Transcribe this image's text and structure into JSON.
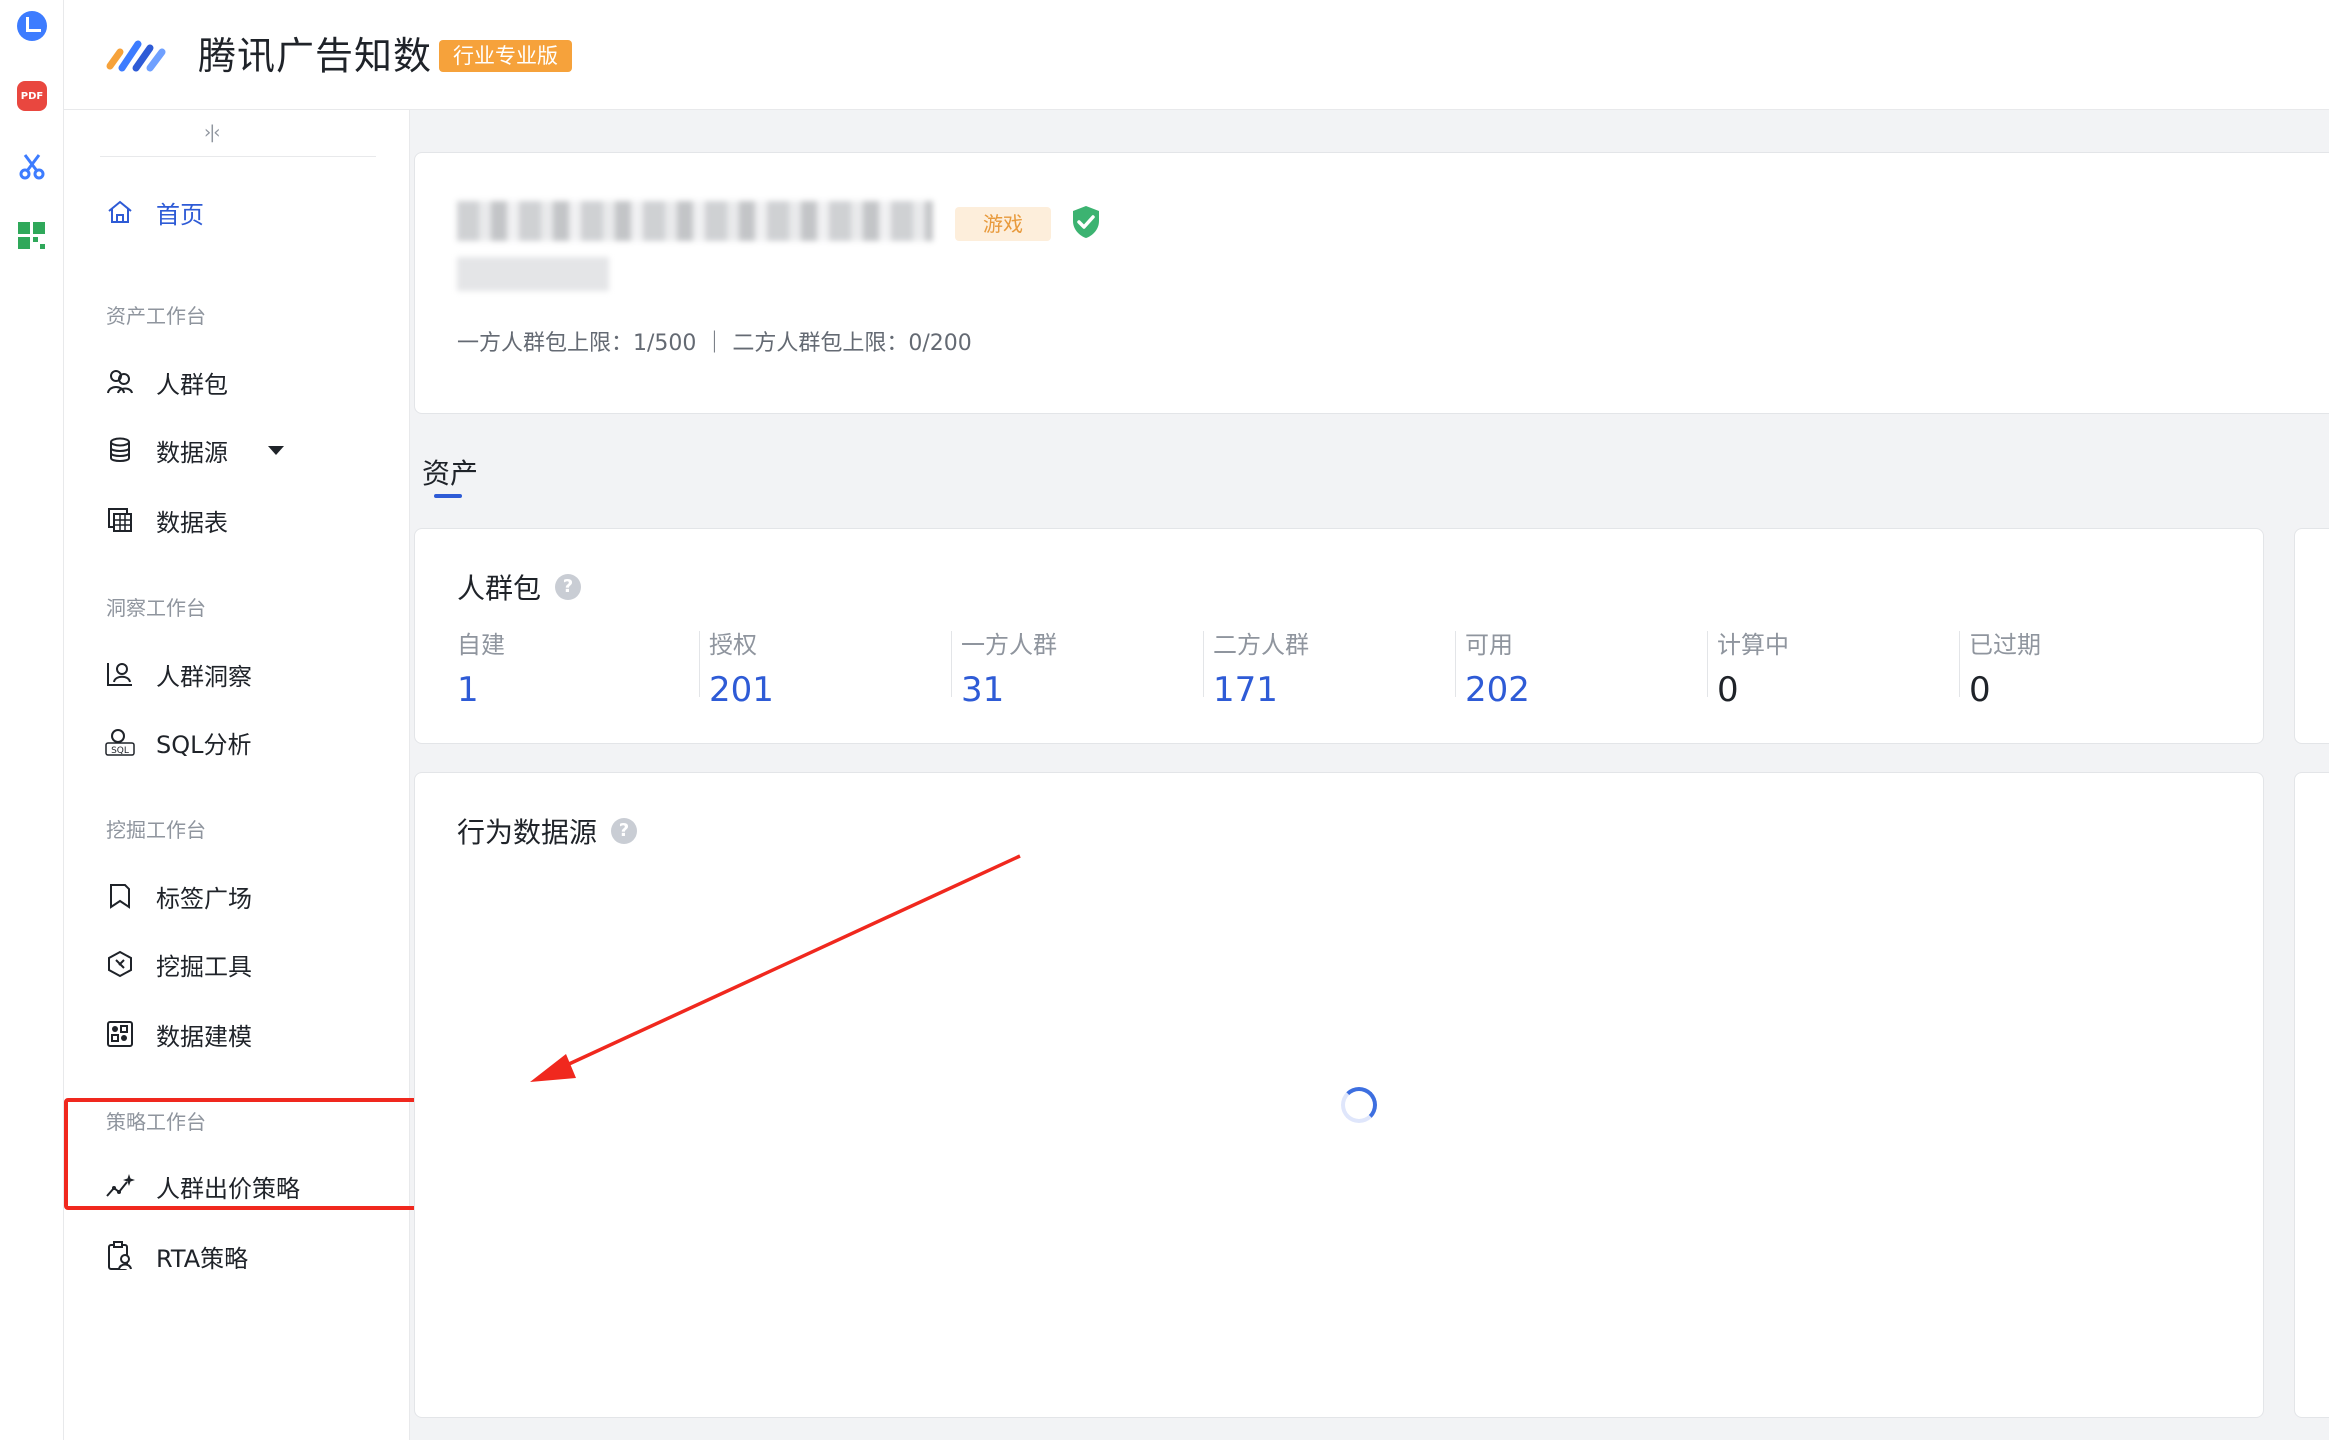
{
  "header": {
    "app_title": "腾讯广告知数",
    "edition_badge": "行业专业版"
  },
  "rail": {
    "pdf_label": "PDF"
  },
  "sidenav": {
    "collapse_glyph": "›|‹",
    "home": "首页",
    "groups": [
      {
        "title": "资产工作台",
        "items": [
          "人群包",
          "数据源",
          "数据表"
        ]
      },
      {
        "title": "洞察工作台",
        "items": [
          "人群洞察",
          "SQL分析"
        ]
      },
      {
        "title": "挖掘工作台",
        "items": [
          "标签广场",
          "挖掘工具",
          "数据建模"
        ]
      },
      {
        "title": "策略工作台",
        "items": [
          "人群出价策略",
          "RTA策略"
        ]
      }
    ]
  },
  "profile": {
    "industry_tag": "游戏",
    "limits_text": "一方人群包上限：1/500 ｜ 二方人群包上限：0/200"
  },
  "tabs": {
    "active": "资产"
  },
  "crowd_card": {
    "title": "人群包",
    "help": "?",
    "stats": [
      {
        "label": "自建",
        "value": "1"
      },
      {
        "label": "授权",
        "value": "201"
      },
      {
        "label": "一方人群",
        "value": "31"
      },
      {
        "label": "二方人群",
        "value": "171"
      },
      {
        "label": "可用",
        "value": "202"
      },
      {
        "label": "计算中",
        "value": "0"
      },
      {
        "label": "已过期",
        "value": "0"
      }
    ]
  },
  "behavior_card": {
    "title": "行为数据源",
    "help": "?"
  },
  "colors": {
    "accent": "#2e5bd6",
    "badge": "#f6a23b",
    "annotation_red": "#f0281e",
    "verified_green": "#3cb371"
  }
}
